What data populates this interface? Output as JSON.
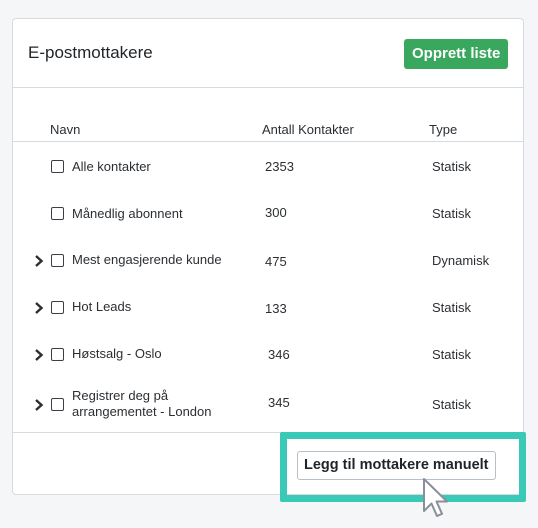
{
  "card": {
    "title": "E-postmottakere",
    "create_label": "Opprett liste"
  },
  "table": {
    "headers": {
      "name": "Navn",
      "count": "Antall Kontakter",
      "type": "Type"
    },
    "rows": [
      {
        "name": "Alle kontakter",
        "count": "2353",
        "type": "Statisk",
        "expandable": false
      },
      {
        "name": "Månedlig abonnent",
        "count": "300",
        "type": "Statisk",
        "expandable": false
      },
      {
        "name": "Mest engasjerende kunde",
        "count": "475",
        "type": "Dynamisk",
        "expandable": true
      },
      {
        "name": "Hot Leads",
        "count": "133",
        "type": "Statisk",
        "expandable": true
      },
      {
        "name": "Høstsalg - Oslo",
        "count": "346",
        "type": "Statisk",
        "expandable": true
      },
      {
        "name": "Registrer deg på arrangementet - London",
        "count": "345",
        "type": "Statisk",
        "expandable": true
      }
    ]
  },
  "footer": {
    "manual_add_label": "Legg til mottakere manuelt"
  },
  "colors": {
    "accent_green": "#3aa75e",
    "highlight_teal": "#39c9b6"
  },
  "icons": {
    "expand": "chevron-right-icon",
    "cursor": "mouse-pointer-icon"
  }
}
